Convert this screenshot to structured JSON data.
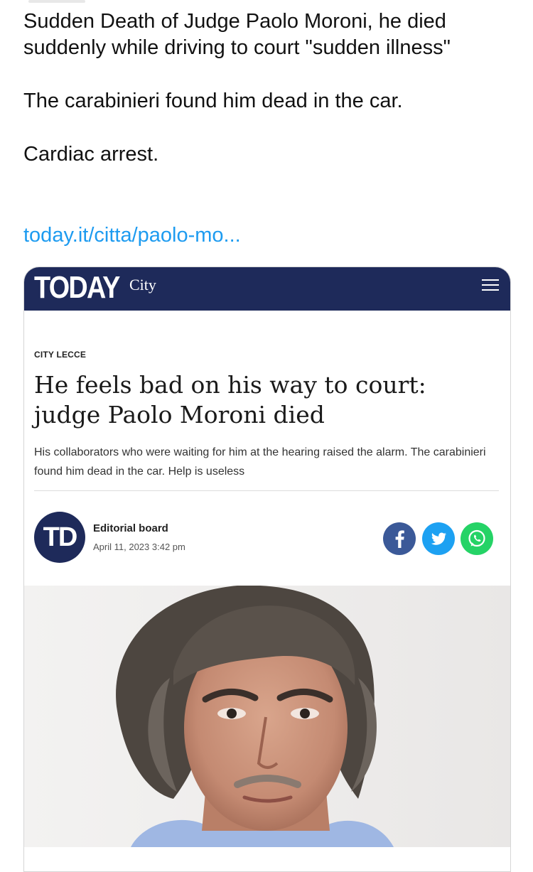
{
  "post": {
    "paragraphs": [
      "Sudden Death of Judge Paolo Moroni, he died suddenly while driving to court \"sudden illness\"",
      "The carabinieri found him dead in the car.",
      "Cardiac arrest."
    ],
    "link_text": "today.it/citta/paolo-mo..."
  },
  "card": {
    "logo": "TODAY",
    "logo_sub": "City",
    "category": "CITY LECCE",
    "headline": "He feels bad on his way to court: judge Paolo Moroni died",
    "summary": "His collaborators who were waiting for him at the hearing raised the alarm. The carabinieri found him dead in the car. Help is useless",
    "author": {
      "initials": "TD",
      "name": "Editorial board",
      "date": "April 11, 2023 3:42 pm"
    },
    "share": [
      {
        "name": "facebook-icon",
        "color": "#3b5998"
      },
      {
        "name": "twitter-icon",
        "color": "#1da1f2"
      },
      {
        "name": "whatsapp-icon",
        "color": "#25d366"
      }
    ],
    "colors": {
      "header": "#1e2a5a",
      "link": "#1d9bf0"
    }
  }
}
